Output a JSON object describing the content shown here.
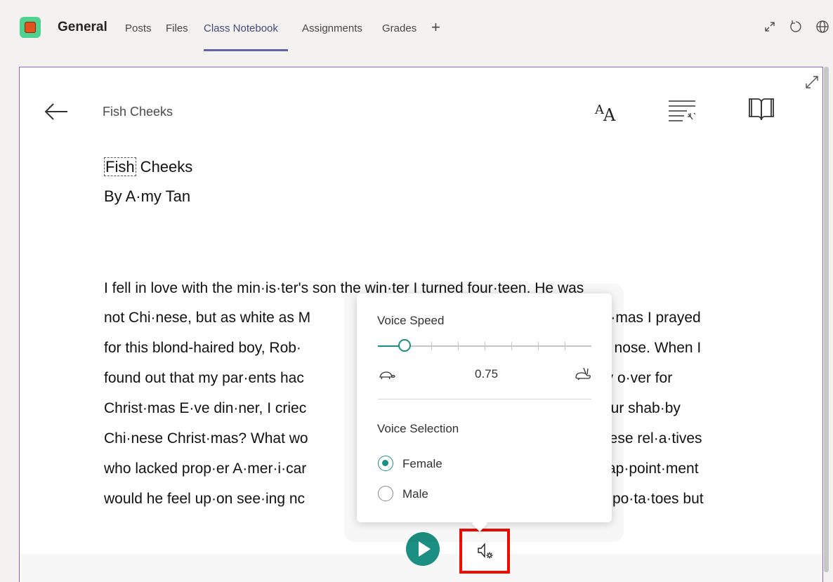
{
  "header": {
    "team_name": "General",
    "tabs": [
      {
        "label": "Posts",
        "active": false
      },
      {
        "label": "Files",
        "active": false
      },
      {
        "label": "Class Notebook",
        "active": true
      },
      {
        "label": "Assignments",
        "active": false
      },
      {
        "label": "Grades",
        "active": false
      }
    ],
    "add_tab": "+",
    "accent_color": "#6264a7",
    "icons": [
      "expand-icon",
      "refresh-icon",
      "globe-icon"
    ]
  },
  "reader": {
    "header_title": "Fish Cheeks",
    "document": {
      "title_highlight": "Fish",
      "title_rest": " Cheeks",
      "author": "By A·my Tan",
      "lines": [
        "I fell in love with the min·is·ter's son the win·ter I turned four·teen. He was",
        "not Chi·nese, but as white as M",
        "for this blond-haired boy, Rob·",
        "found out that my par·ents hac",
        "Christ·mas E·ve din·ner, I criec",
        "Chi·nese Christ·mas? What wo",
        "who lacked prop·er A·mer·i·car",
        "would he feel up·on see·ing nc"
      ],
      "lines_right": [
        "st·mas I prayed",
        "n nose. When I",
        "ly o·ver for",
        "our shab·by",
        "nese rel·a·tives",
        "·ap·point·ment",
        "po·ta·toes but"
      ]
    },
    "toolbar_icons": [
      "back-arrow-icon",
      "text-size-icon",
      "grammar-options-icon",
      "reading-preferences-icon",
      "expand-icon"
    ],
    "play_color": "#1b8f82"
  },
  "voice_popup": {
    "speed_label": "Voice Speed",
    "speed_value": "0.75",
    "speed_fraction": 0.125,
    "selection_label": "Voice Selection",
    "options": [
      {
        "label": "Female",
        "checked": true
      },
      {
        "label": "Male",
        "checked": false
      }
    ],
    "accent_color": "#1b8f82"
  }
}
